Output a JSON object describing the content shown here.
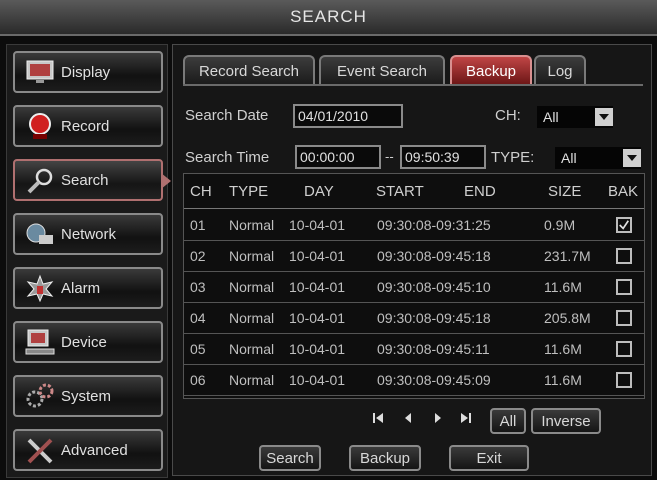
{
  "window": {
    "title": "SEARCH"
  },
  "sidebar": {
    "items": [
      {
        "label": "Display",
        "icon": "monitor-icon"
      },
      {
        "label": "Record",
        "icon": "record-icon"
      },
      {
        "label": "Search",
        "icon": "magnifier-icon",
        "active": true
      },
      {
        "label": "Network",
        "icon": "network-icon"
      },
      {
        "label": "Alarm",
        "icon": "alarm-icon"
      },
      {
        "label": "Device",
        "icon": "device-icon"
      },
      {
        "label": "System",
        "icon": "system-gears-icon"
      },
      {
        "label": "Advanced",
        "icon": "tools-icon"
      }
    ]
  },
  "tabs": [
    {
      "label": "Record Search"
    },
    {
      "label": "Event Search"
    },
    {
      "label": "Backup",
      "active": true
    },
    {
      "label": "Log"
    }
  ],
  "form": {
    "search_date_label": "Search Date",
    "search_date_value": "04/01/2010",
    "ch_label": "CH:",
    "ch_value": "All",
    "search_time_label": "Search Time",
    "time_start": "00:00:00",
    "time_sep": "--",
    "time_end": "09:50:39",
    "type_label": "TYPE:",
    "type_value": "All"
  },
  "table": {
    "headers": [
      "CH",
      "TYPE",
      "DAY",
      "START",
      "END",
      "SIZE",
      "BAK"
    ],
    "rows": [
      {
        "ch": "01",
        "type": "Normal",
        "day": "10-04-01",
        "range": "09:30:08-09:31:25",
        "size": "0.9M",
        "checked": true
      },
      {
        "ch": "02",
        "type": "Normal",
        "day": "10-04-01",
        "range": "09:30:08-09:45:18",
        "size": "231.7M",
        "checked": false
      },
      {
        "ch": "03",
        "type": "Normal",
        "day": "10-04-01",
        "range": "09:30:08-09:45:10",
        "size": "11.6M",
        "checked": false
      },
      {
        "ch": "04",
        "type": "Normal",
        "day": "10-04-01",
        "range": "09:30:08-09:45:18",
        "size": "205.8M",
        "checked": false
      },
      {
        "ch": "05",
        "type": "Normal",
        "day": "10-04-01",
        "range": "09:30:08-09:45:11",
        "size": "11.6M",
        "checked": false
      },
      {
        "ch": "06",
        "type": "Normal",
        "day": "10-04-01",
        "range": "09:30:08-09:45:09",
        "size": "11.6M",
        "checked": false
      }
    ]
  },
  "pager": {
    "all_label": "All",
    "inverse_label": "Inverse"
  },
  "actions": {
    "search_label": "Search",
    "backup_label": "Backup",
    "exit_label": "Exit"
  },
  "colors": {
    "active_tab": "#c04545",
    "background": "#0c0c0c",
    "border": "#8a8a8a"
  }
}
